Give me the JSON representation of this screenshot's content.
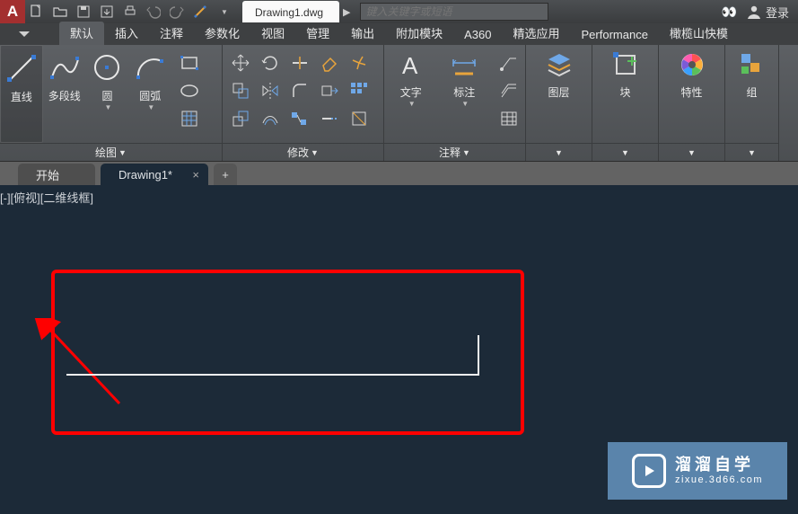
{
  "app": {
    "icon_letter": "A"
  },
  "document": {
    "title": "Drawing1.dwg",
    "close": "×"
  },
  "search": {
    "placeholder": "键入关键字或短语"
  },
  "login": {
    "label": "登录"
  },
  "ribbon_tabs": {
    "t0": "默认",
    "t1": "插入",
    "t2": "注释",
    "t3": "参数化",
    "t4": "视图",
    "t5": "管理",
    "t6": "输出",
    "t7": "附加模块",
    "t8": "A360",
    "t9": "精选应用",
    "t10": "Performance",
    "t11": "橄榄山快模"
  },
  "panels": {
    "draw": {
      "title": "绘图",
      "line": "直线",
      "polyline": "多段线",
      "circle": "圆",
      "arc": "圆弧"
    },
    "modify": {
      "title": "修改"
    },
    "annot": {
      "title": "注释",
      "text": "文字",
      "dim": "标注"
    },
    "layer": {
      "title": "图层"
    },
    "block": {
      "title": "块"
    },
    "prop": {
      "title": "特性"
    },
    "group": {
      "title": "组"
    }
  },
  "file_tabs": {
    "start": "开始",
    "drawing": "Drawing1*",
    "plus": "+"
  },
  "canvas": {
    "view_label": "[-][俯视][二维线框]"
  },
  "watermark": {
    "brand": "溜溜自学",
    "url": "zixue.3d66.com"
  }
}
